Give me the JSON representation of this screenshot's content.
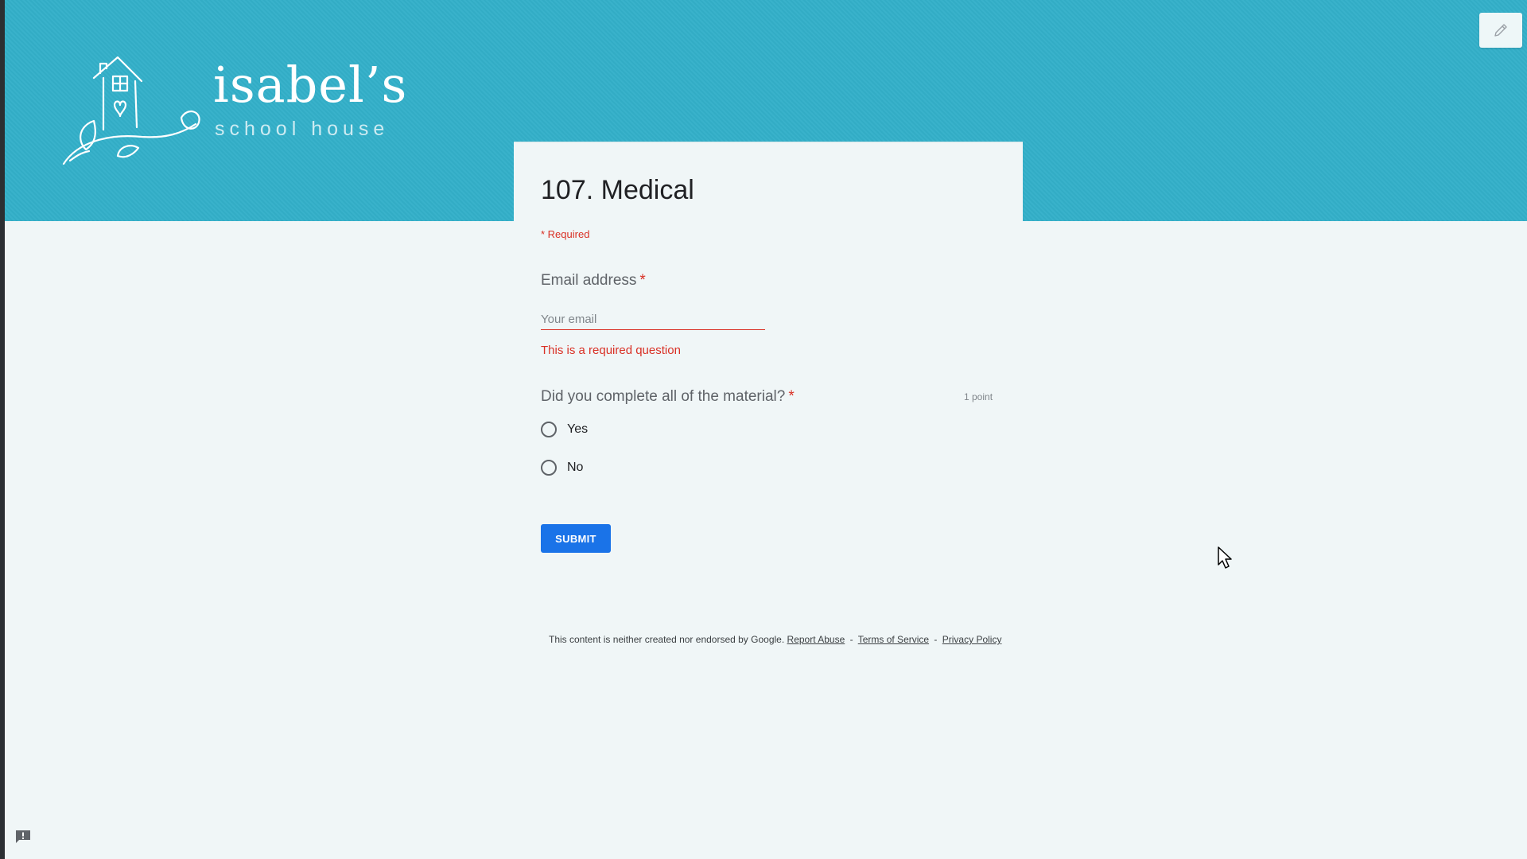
{
  "header": {
    "logo_title": "isabel’s",
    "logo_subtitle": "school house"
  },
  "form": {
    "title": "107. Medical",
    "required_note": "* Required",
    "email_question": {
      "label": "Email address",
      "required_mark": "*",
      "placeholder": "Your email",
      "value": "",
      "error": "This is a required question"
    },
    "material_question": {
      "label": "Did you complete all of the material?",
      "required_mark": "*",
      "points": "1 point",
      "options": [
        "Yes",
        "No"
      ]
    },
    "submit_label": "SUBMIT"
  },
  "footer": {
    "disclaimer": "This content is neither created nor endorsed by Google.",
    "links": [
      "Report Abuse",
      "Terms of Service",
      "Privacy Policy"
    ],
    "separator": "-"
  },
  "icons": {
    "edit": "pencil-icon",
    "feedback": "feedback-icon",
    "logo": "house-logo-icon"
  },
  "colors": {
    "header_bg": "#33afc9",
    "page_bg": "#f0f6f7",
    "error": "#d93025",
    "button": "#1a73e8"
  }
}
